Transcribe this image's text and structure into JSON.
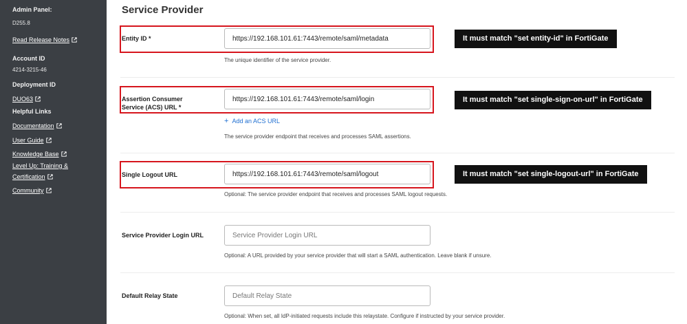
{
  "sidebar": {
    "admin_panel_label": "Admin Panel:",
    "version": "D255.8",
    "release_notes": "Read Release Notes",
    "account_id_label": "Account ID",
    "account_id": "4214-3215-46",
    "deployment_id_label": "Deployment ID",
    "deployment_id": "DUO63",
    "helpful_links_label": "Helpful Links",
    "links": [
      "Documentation",
      "User Guide",
      "Knowledge Base",
      "Level Up: Training &",
      "Certification",
      "Community"
    ]
  },
  "main": {
    "title": "Service Provider",
    "fields": {
      "entity_id": {
        "label": "Entity ID *",
        "value": "https://192.168.101.61:7443/remote/saml/metadata",
        "help": "The unique identifier of the service provider."
      },
      "acs_url": {
        "label_line1": "Assertion Consumer",
        "label_line2": "Service (ACS) URL *",
        "value": "https://192.168.101.61:7443/remote/saml/login",
        "add_link": "Add an ACS URL",
        "help": "The service provider endpoint that receives and processes SAML assertions."
      },
      "logout_url": {
        "label": "Single Logout URL",
        "value": "https://192.168.101.61:7443/remote/saml/logout",
        "help": "Optional: The service provider endpoint that receives and processes SAML logout requests."
      },
      "sp_login_url": {
        "label": "Service Provider Login URL",
        "placeholder": "Service Provider Login URL",
        "help": "Optional: A URL provided by your service provider that will start a SAML authentication. Leave blank if unsure."
      },
      "relay_state": {
        "label": "Default Relay State",
        "placeholder": "Default Relay State",
        "help": "Optional: When set, all IdP-initiated requests include this relaystate. Configure if instructed by your service provider."
      }
    }
  },
  "callouts": {
    "entity_id": "It must match \"set entity-id\" in FortiGate",
    "sso_url": "It must match \"set single-sign-on-url\" in FortiGate",
    "logout_url": "It must match \"set single-logout-url\" in FortiGate"
  },
  "colors": {
    "sidebar_bg": "#3b3f44",
    "highlight_red": "#d6141c",
    "link_blue": "#1f6fd1",
    "callout_bg": "#111111"
  }
}
